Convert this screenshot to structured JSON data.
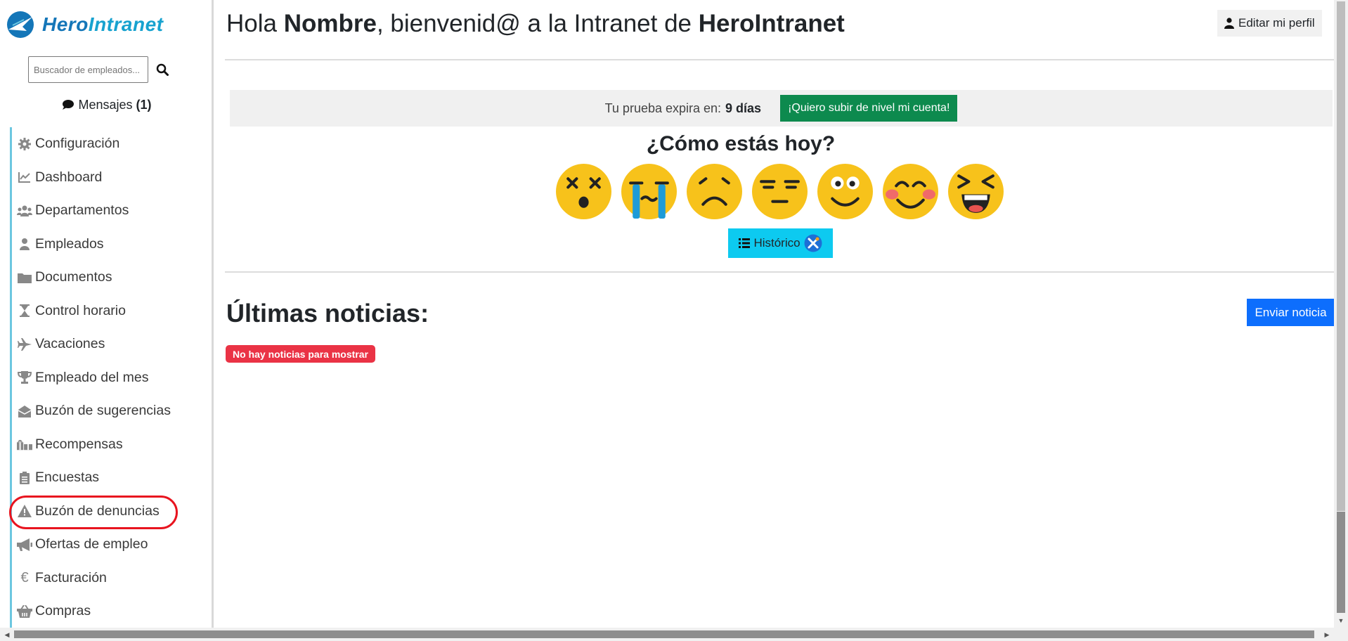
{
  "brand": {
    "name_1": "Hero",
    "name_2": "Intranet"
  },
  "search": {
    "placeholder": "Buscador de empleados..."
  },
  "messages": {
    "label": "Mensajes",
    "count": "(1)"
  },
  "nav": [
    {
      "label": "Configuración",
      "icon": "gear-icon"
    },
    {
      "label": "Dashboard",
      "icon": "chart-line-icon"
    },
    {
      "label": "Departamentos",
      "icon": "users-icon"
    },
    {
      "label": "Empleados",
      "icon": "user-icon"
    },
    {
      "label": "Documentos",
      "icon": "folder-icon"
    },
    {
      "label": "Control horario",
      "icon": "hourglass-icon"
    },
    {
      "label": "Vacaciones",
      "icon": "plane-icon"
    },
    {
      "label": "Empleado del mes",
      "icon": "trophy-icon"
    },
    {
      "label": "Buzón de sugerencias",
      "icon": "envelope-open-icon"
    },
    {
      "label": "Recompensas",
      "icon": "gifts-icon"
    },
    {
      "label": "Encuestas",
      "icon": "clipboard-list-icon"
    },
    {
      "label": "Buzón de denuncias",
      "icon": "warning-icon"
    },
    {
      "label": "Ofertas de empleo",
      "icon": "megaphone-icon"
    },
    {
      "label": "Facturación",
      "icon": "euro-icon"
    },
    {
      "label": "Compras",
      "icon": "basket-icon"
    }
  ],
  "header": {
    "hola": "Hola ",
    "name": "Nombre",
    "middle": ", bienvenid@ a la Intranet de ",
    "company": "HeroIntranet",
    "profile_button": "Editar mi perfil"
  },
  "trial": {
    "text": "Tu prueba expira en:",
    "days": "9 días",
    "upgrade_button": "¡Quiero subir de nivel mi cuenta!"
  },
  "mood": {
    "title": "¿Cómo estás hoy?",
    "emojis": [
      "dizzy-face-icon",
      "crying-face-icon",
      "sad-face-icon",
      "expressionless-face-icon",
      "smiling-face-icon",
      "blushing-face-icon",
      "laughing-face-icon"
    ],
    "history_button": "Histórico"
  },
  "news": {
    "title": "Últimas noticias:",
    "send_button": "Enviar noticia",
    "empty_message": "No hay noticias para mostrar"
  },
  "colors": {
    "brand_blue": "#1476b8",
    "nav_border": "#6cc7e0",
    "upgrade_green": "#0d8a4e",
    "history_cyan": "#0dcaf0",
    "primary_blue": "#0d6efd",
    "danger_red": "#ea3345",
    "highlight_circle": "#e8141f"
  }
}
